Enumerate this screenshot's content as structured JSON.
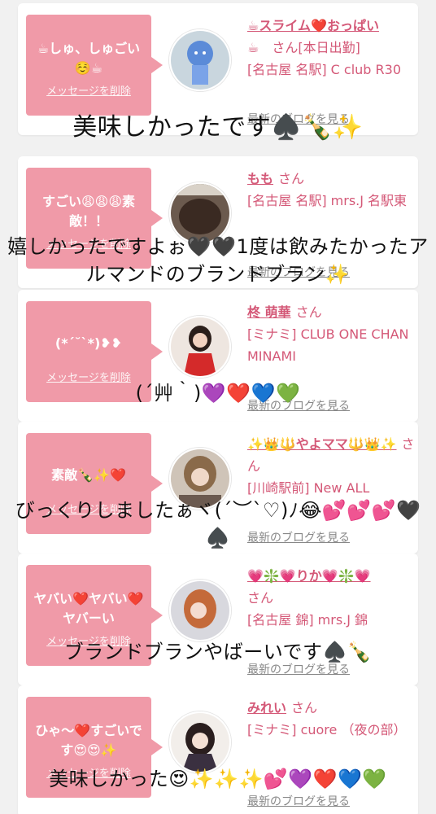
{
  "cards": [
    {
      "bubble_text": "☕しゅ、しゅごい☺️☕",
      "delete_label": "メッセージを削除",
      "name": "☕スライム❤️おっぱい",
      "name_suffix": "☕　さん[本日出勤]",
      "location": "[名古屋 名駅] C club R30",
      "blog_link": "最新のブログを見る"
    },
    {
      "bubble_text": "すごい😩😩😩素敵！！",
      "delete_label": "メッセージを削除",
      "name": "もも",
      "name_suffix": "さん",
      "location": "[名古屋 名駅] mrs.J 名駅東",
      "blog_link": "最新のブログを見る"
    },
    {
      "bubble_text": "(*ˊ˘ˋ*)❥❥",
      "delete_label": "メッセージを削除",
      "name": "柊 萌華",
      "name_suffix": "さん",
      "location": "[ミナミ] CLUB ONE CHAN MINAMI",
      "blog_link": "最新のブログを見る"
    },
    {
      "bubble_text": "素敵🍾✨❤️",
      "delete_label": "メッセージを削除",
      "name": "✨👑🔱やよママ🔱👑✨",
      "name_suffix": "さん",
      "location": "[川崎駅前] New ALL",
      "blog_link": "最新のブログを見る"
    },
    {
      "bubble_text": "ヤバい❤️ヤバい❤️ヤバーい",
      "delete_label": "メッセージを削除",
      "name": "💗❇️💗りか💗❇️💗",
      "name_suffix": "さん",
      "location": "[名古屋 錦] mrs.J 錦",
      "blog_link": "最新のブログを見る"
    },
    {
      "bubble_text": "ひゃ〜❤️すごいです😍😍✨",
      "delete_label": "メッセージを削除",
      "name": "みれい",
      "name_suffix": "さん",
      "location": "[ミナミ] cuore （夜の部）",
      "blog_link": "最新のブログを見る"
    }
  ],
  "overlays": [
    "美味しかったです♠️🍾✨",
    "嬉しかったですよぉ🖤🖤1度は飲みたかったアルマンドのブランドブラン✨",
    "(´艸｀)💜❤️💙💚",
    "びっくりしましたぁヾ(´︶`♡)ﾉ😂💕💕💕🖤♠️",
    "ブランドブランやばーいです♠️🍾",
    "美味しかった😍✨✨✨💕💜❤️💙💚"
  ],
  "colors": {
    "bubble": "#f09aa8",
    "accent_text": "#d45877",
    "link_gray": "#888888",
    "background": "#f1f1f1"
  }
}
